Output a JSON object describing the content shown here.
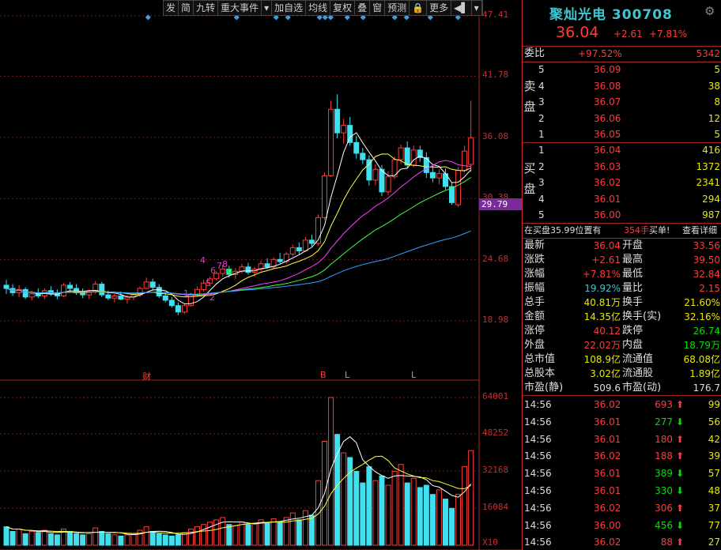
{
  "toolbar": {
    "items": [
      "发",
      "简",
      "九转",
      "重大事件",
      "▾",
      "加自选",
      "均线",
      "复权",
      "叠",
      "窗",
      "预测",
      "🔒",
      "更多",
      "◀▌",
      "▾"
    ]
  },
  "price_axis": {
    "labels": [
      "47.41",
      "41.78",
      "36.08",
      "30.38",
      "24.68",
      "18.98"
    ],
    "current": "29.79"
  },
  "volume_axis": {
    "labels": [
      "64001",
      "48252",
      "32168",
      "16084",
      "X10"
    ]
  },
  "events": [
    {
      "label": "财",
      "color": "#ff4040"
    },
    {
      "label": "B",
      "color": "#ff4040"
    },
    {
      "label": "L",
      "color": "#3fc6d0"
    },
    {
      "label": "L",
      "color": "#3fc6d0"
    }
  ],
  "nine_turn": [
    {
      "t": "1",
      "c": "#d040d0"
    },
    {
      "t": "2",
      "c": "#d040d0"
    },
    {
      "t": "4",
      "c": "#d040d0"
    },
    {
      "t": "5",
      "c": "#d040d0"
    },
    {
      "t": "6",
      "c": "#d040d0"
    },
    {
      "t": "7",
      "c": "#d040d0"
    },
    {
      "t": "8",
      "c": "#d040d0"
    },
    {
      "t": "9",
      "c": "#00e000"
    }
  ],
  "colors": {
    "up": "#ff3b3b",
    "down": "#3fe0f0",
    "ma5": "#ffffff",
    "ma10": "#ffff40",
    "ma20": "#ff40ff",
    "ma60": "#40ff40",
    "ma120": "#30a0ff",
    "grid": "#7a1818"
  },
  "chart_data": {
    "type": "candlestick",
    "price_ylim": [
      18.98,
      47.41
    ],
    "volume_ylim": [
      0,
      64001
    ],
    "ohlc": [
      [
        22.3,
        22.8,
        21.5,
        22.0
      ],
      [
        22.0,
        22.4,
        21.3,
        21.6
      ],
      [
        21.6,
        22.3,
        21.2,
        21.9
      ],
      [
        21.9,
        22.1,
        21.0,
        21.2
      ],
      [
        21.2,
        21.8,
        20.9,
        21.5
      ],
      [
        21.5,
        22.0,
        21.1,
        21.3
      ],
      [
        21.3,
        22.0,
        21.0,
        21.8
      ],
      [
        21.8,
        22.2,
        21.3,
        21.5
      ],
      [
        21.5,
        21.9,
        21.0,
        21.3
      ],
      [
        21.3,
        22.5,
        21.2,
        22.3
      ],
      [
        22.3,
        22.6,
        21.7,
        22.0
      ],
      [
        22.0,
        22.4,
        21.4,
        21.6
      ],
      [
        21.6,
        22.0,
        21.1,
        21.4
      ],
      [
        21.4,
        21.9,
        21.0,
        21.7
      ],
      [
        21.7,
        22.7,
        21.5,
        22.4
      ],
      [
        22.4,
        22.6,
        21.2,
        21.4
      ],
      [
        21.4,
        21.8,
        20.9,
        21.1
      ],
      [
        21.1,
        21.5,
        20.7,
        21.3
      ],
      [
        21.3,
        21.7,
        20.9,
        21.0
      ],
      [
        21.0,
        21.4,
        20.6,
        21.2
      ],
      [
        21.2,
        21.6,
        20.9,
        21.4
      ],
      [
        21.4,
        22.2,
        21.2,
        22.0
      ],
      [
        22.0,
        23.0,
        21.9,
        22.6
      ],
      [
        22.6,
        22.9,
        21.8,
        22.1
      ],
      [
        22.1,
        22.4,
        21.1,
        21.3
      ],
      [
        21.3,
        21.6,
        20.7,
        20.9
      ],
      [
        20.9,
        21.2,
        20.2,
        20.4
      ],
      [
        20.4,
        20.7,
        19.5,
        19.8
      ],
      [
        19.8,
        20.6,
        19.6,
        20.4
      ],
      [
        20.4,
        21.6,
        20.3,
        21.4
      ],
      [
        21.4,
        22.2,
        21.2,
        21.9
      ],
      [
        21.9,
        22.8,
        21.7,
        22.5
      ],
      [
        22.5,
        23.1,
        22.2,
        22.9
      ],
      [
        22.9,
        23.6,
        22.7,
        23.4
      ],
      [
        23.4,
        24.2,
        23.1,
        23.8
      ],
      [
        23.8,
        24.1,
        23.0,
        23.3
      ],
      [
        23.3,
        23.9,
        22.9,
        23.6
      ],
      [
        23.6,
        24.3,
        23.4,
        24.0
      ],
      [
        24.0,
        24.4,
        23.3,
        23.5
      ],
      [
        23.5,
        24.0,
        23.1,
        23.8
      ],
      [
        23.8,
        24.6,
        23.6,
        24.3
      ],
      [
        24.3,
        24.8,
        23.8,
        24.0
      ],
      [
        24.0,
        24.9,
        23.8,
        24.7
      ],
      [
        24.7,
        25.3,
        24.3,
        24.5
      ],
      [
        24.5,
        25.4,
        24.3,
        25.2
      ],
      [
        25.2,
        26.1,
        25.0,
        25.8
      ],
      [
        25.8,
        26.3,
        25.2,
        25.5
      ],
      [
        25.5,
        26.8,
        25.4,
        26.5
      ],
      [
        26.5,
        27.0,
        25.9,
        26.2
      ],
      [
        26.2,
        28.9,
        26.0,
        28.6
      ],
      [
        28.6,
        32.8,
        28.4,
        32.5
      ],
      [
        32.5,
        39.5,
        32.4,
        38.7
      ],
      [
        38.7,
        40.1,
        36.0,
        36.5
      ],
      [
        36.5,
        37.8,
        35.5,
        37.2
      ],
      [
        37.2,
        38.0,
        35.3,
        35.6
      ],
      [
        35.6,
        36.2,
        34.1,
        34.6
      ],
      [
        34.6,
        35.1,
        33.6,
        34.0
      ],
      [
        34.0,
        34.4,
        31.6,
        32.1
      ],
      [
        32.1,
        33.6,
        31.6,
        33.1
      ],
      [
        33.1,
        33.5,
        30.6,
        31.0
      ],
      [
        31.0,
        32.9,
        30.7,
        32.4
      ],
      [
        32.4,
        34.3,
        32.2,
        34.0
      ],
      [
        34.0,
        35.4,
        33.6,
        35.1
      ],
      [
        35.1,
        35.7,
        33.2,
        33.5
      ],
      [
        33.5,
        35.3,
        33.3,
        34.9
      ],
      [
        34.9,
        35.3,
        33.8,
        34.2
      ],
      [
        34.2,
        34.7,
        32.3,
        32.8
      ],
      [
        32.8,
        33.5,
        31.9,
        32.3
      ],
      [
        32.3,
        33.1,
        31.7,
        32.7
      ],
      [
        32.7,
        33.2,
        31.2,
        31.5
      ],
      [
        31.5,
        31.9,
        29.8,
        30.0
      ],
      [
        29.8,
        33.3,
        29.6,
        33.0
      ],
      [
        33.0,
        35.3,
        32.8,
        34.8
      ],
      [
        33.56,
        39.5,
        32.84,
        36.04
      ]
    ],
    "volume": [
      8000,
      6000,
      7000,
      5000,
      6000,
      5500,
      6500,
      5000,
      4500,
      7000,
      6000,
      5000,
      4500,
      5000,
      7500,
      6000,
      5000,
      4500,
      4000,
      4500,
      5000,
      6500,
      8000,
      6000,
      5000,
      4500,
      4000,
      4500,
      5500,
      7000,
      8000,
      9000,
      10000,
      11000,
      12000,
      9000,
      8500,
      10000,
      9000,
      9500,
      11000,
      9500,
      11500,
      10000,
      12000,
      14000,
      11000,
      15000,
      13000,
      28000,
      45000,
      64001,
      48000,
      40000,
      38000,
      32000,
      27000,
      34000,
      28000,
      30000,
      26000,
      32000,
      35000,
      27000,
      29000,
      25000,
      26000,
      22000,
      24000,
      20000,
      16000,
      22000,
      34000,
      41000
    ],
    "xlabel": "",
    "ylabel": ""
  },
  "quote": {
    "name": "聚灿光电 300708",
    "price": "36.04",
    "change": "+2.61",
    "pct": "+7.81%"
  },
  "weibi": {
    "label": "委比",
    "pct": "+97.52%",
    "diff": "5342"
  },
  "asks": [
    {
      "n": "5",
      "p": "36.09",
      "v": "5"
    },
    {
      "n": "4",
      "p": "36.08",
      "v": "38"
    },
    {
      "n": "3",
      "p": "36.07",
      "v": "8"
    },
    {
      "n": "2",
      "p": "36.06",
      "v": "12"
    },
    {
      "n": "1",
      "p": "36.05",
      "v": "5"
    }
  ],
  "bids": [
    {
      "n": "1",
      "p": "36.04",
      "v": "416"
    },
    {
      "n": "2",
      "p": "36.03",
      "v": "1372"
    },
    {
      "n": "3",
      "p": "36.02",
      "v": "2341"
    },
    {
      "n": "4",
      "p": "36.01",
      "v": "294"
    },
    {
      "n": "5",
      "p": "36.00",
      "v": "987"
    }
  ],
  "sides": {
    "sell": [
      "卖",
      "盘"
    ],
    "buy": [
      "买",
      "盘"
    ]
  },
  "bar": {
    "text": "在买盘35.99位置有",
    "qty": "354手",
    "buy": "买单!",
    "detail": "查看详细"
  },
  "stats": [
    {
      "l": "最新",
      "v": "36.04",
      "vc": "red",
      "l2": "开盘",
      "v2": "33.56",
      "v2c": "red"
    },
    {
      "l": "涨跌",
      "v": "+2.61",
      "vc": "red",
      "l2": "最高",
      "v2": "39.50",
      "v2c": "red"
    },
    {
      "l": "涨幅",
      "v": "+7.81%",
      "vc": "red",
      "l2": "最低",
      "v2": "32.84",
      "v2c": "red"
    },
    {
      "l": "振幅",
      "v": "19.92%",
      "vc": "cyan",
      "l2": "量比",
      "v2": "2.15",
      "v2c": "red"
    },
    {
      "l": "总手",
      "v": "40.81万",
      "vc": "yel",
      "l2": "换手",
      "v2": "21.60%",
      "v2c": "yel"
    },
    {
      "l": "金额",
      "v": "14.35亿",
      "vc": "yel",
      "l2": "换手(实)",
      "v2": "32.16%",
      "v2c": "yel"
    },
    {
      "l": "涨停",
      "v": "40.12",
      "vc": "red",
      "l2": "跌停",
      "v2": "26.74",
      "v2c": "grn"
    },
    {
      "l": "外盘",
      "v": "22.02万",
      "vc": "red",
      "l2": "内盘",
      "v2": "18.79万",
      "v2c": "grn"
    },
    {
      "l": "总市值",
      "v": "108.9亿",
      "vc": "yel",
      "l2": "流通值",
      "v2": "68.08亿",
      "v2c": "yel"
    },
    {
      "l": "总股本",
      "v": "3.02亿",
      "vc": "yel",
      "l2": "流通股",
      "v2": "1.89亿",
      "v2c": "yel"
    },
    {
      "l": "市盈(静)",
      "v": "509.6",
      "vc": "wht",
      "l2": "市盈(动)",
      "v2": "176.7",
      "v2c": "wht"
    }
  ],
  "ticks": [
    {
      "t": "14:56",
      "p": "36.02",
      "v": "693",
      "d": "up",
      "n": "99"
    },
    {
      "t": "14:56",
      "p": "36.01",
      "v": "277",
      "d": "down",
      "n": "56"
    },
    {
      "t": "14:56",
      "p": "36.01",
      "v": "180",
      "d": "up",
      "n": "42"
    },
    {
      "t": "14:56",
      "p": "36.02",
      "v": "188",
      "d": "up",
      "n": "39"
    },
    {
      "t": "14:56",
      "p": "36.01",
      "v": "389",
      "d": "down",
      "n": "57"
    },
    {
      "t": "14:56",
      "p": "36.01",
      "v": "330",
      "d": "down",
      "n": "48"
    },
    {
      "t": "14:56",
      "p": "36.02",
      "v": "306",
      "d": "up",
      "n": "37"
    },
    {
      "t": "14:56",
      "p": "36.00",
      "v": "456",
      "d": "down",
      "n": "77"
    },
    {
      "t": "14:56",
      "p": "36.02",
      "v": "88",
      "d": "up",
      "n": "27"
    }
  ]
}
